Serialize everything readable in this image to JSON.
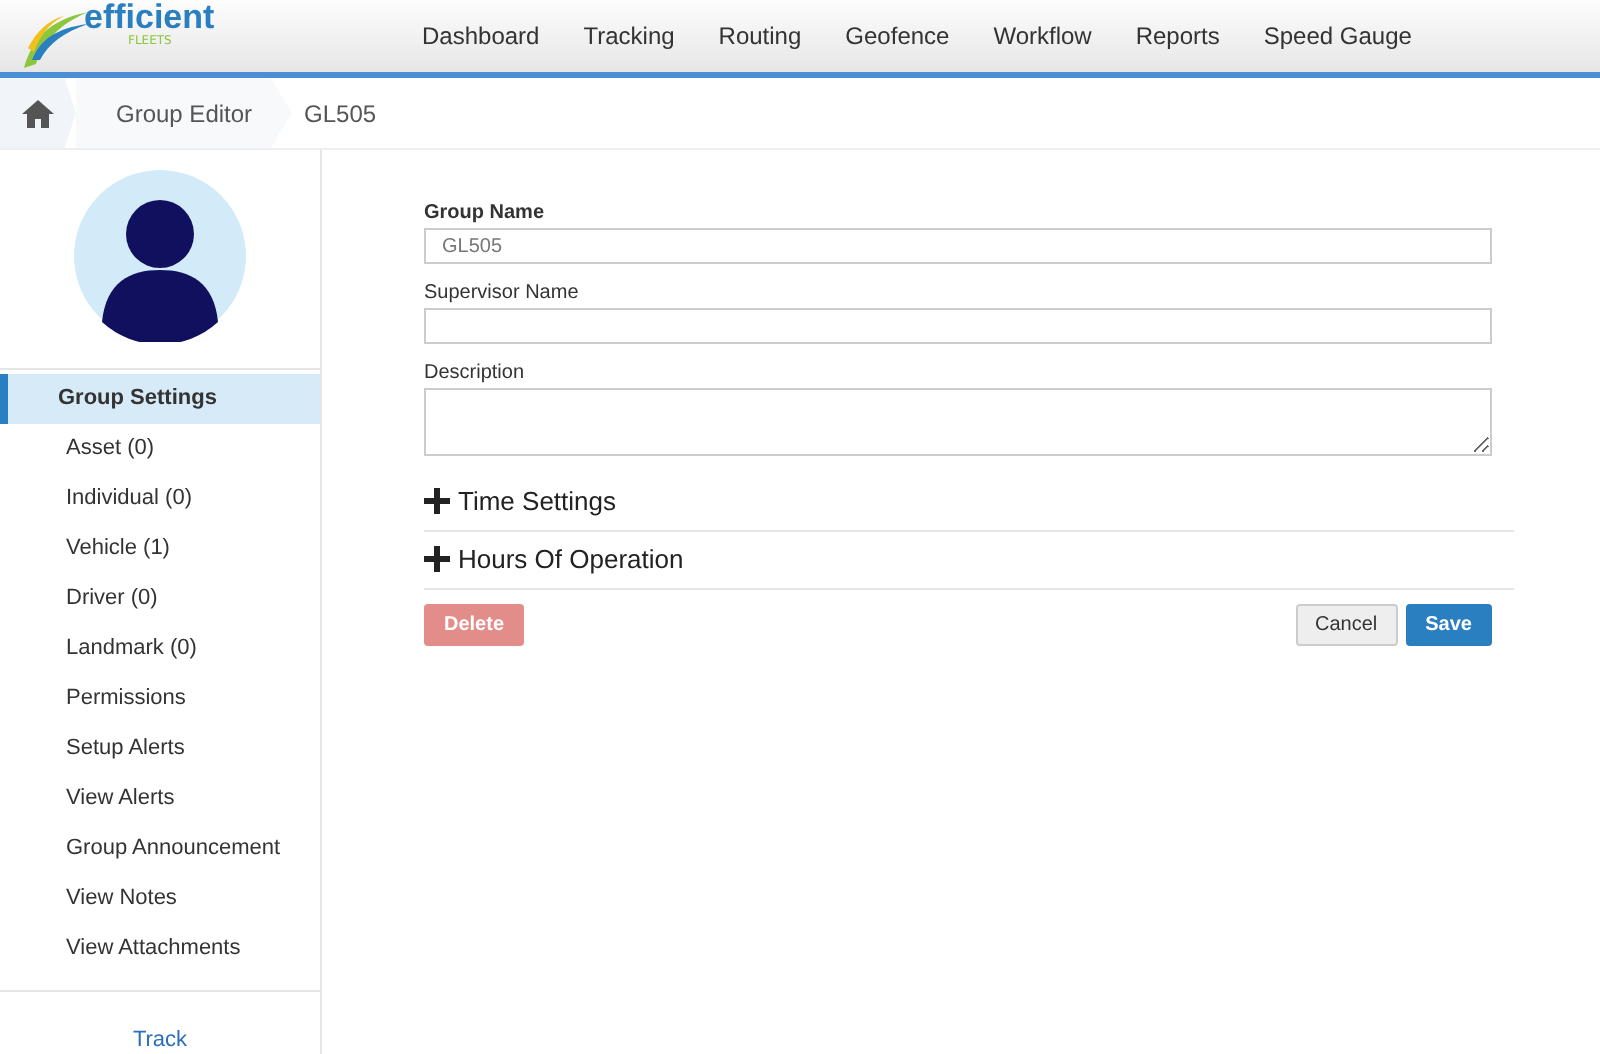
{
  "logo": {
    "word": "efficient",
    "sub": "FLEETS"
  },
  "nav": [
    "Dashboard",
    "Tracking",
    "Routing",
    "Geofence",
    "Workflow",
    "Reports",
    "Speed Gauge"
  ],
  "breadcrumb": [
    "Group Editor",
    "GL505"
  ],
  "sidebar": {
    "items": [
      {
        "label": "Group Settings",
        "selected": true
      },
      {
        "label": "Asset (0)",
        "selected": false
      },
      {
        "label": "Individual (0)",
        "selected": false
      },
      {
        "label": "Vehicle (1)",
        "selected": false
      },
      {
        "label": "Driver (0)",
        "selected": false
      },
      {
        "label": "Landmark (0)",
        "selected": false
      },
      {
        "label": "Permissions",
        "selected": false
      },
      {
        "label": "Setup Alerts",
        "selected": false
      },
      {
        "label": "View Alerts",
        "selected": false
      },
      {
        "label": "Group Announcement",
        "selected": false
      },
      {
        "label": "View Notes",
        "selected": false
      },
      {
        "label": "View Attachments",
        "selected": false
      }
    ],
    "footer_link": "Track"
  },
  "form": {
    "fields": [
      {
        "kind": "input",
        "label": "Group Name",
        "value": "GL505",
        "bold": true
      },
      {
        "kind": "input",
        "label": "Supervisor Name",
        "bold": false
      },
      {
        "kind": "textarea",
        "label": "Description",
        "bold": false
      }
    ],
    "sections": [
      {
        "label": "Time Settings",
        "expanded": false
      },
      {
        "label": "Hours Of Operation",
        "expanded": false
      }
    ],
    "delete": {
      "label": "Delete",
      "disabled": true
    },
    "cancel": "Cancel",
    "save": "Save"
  }
}
